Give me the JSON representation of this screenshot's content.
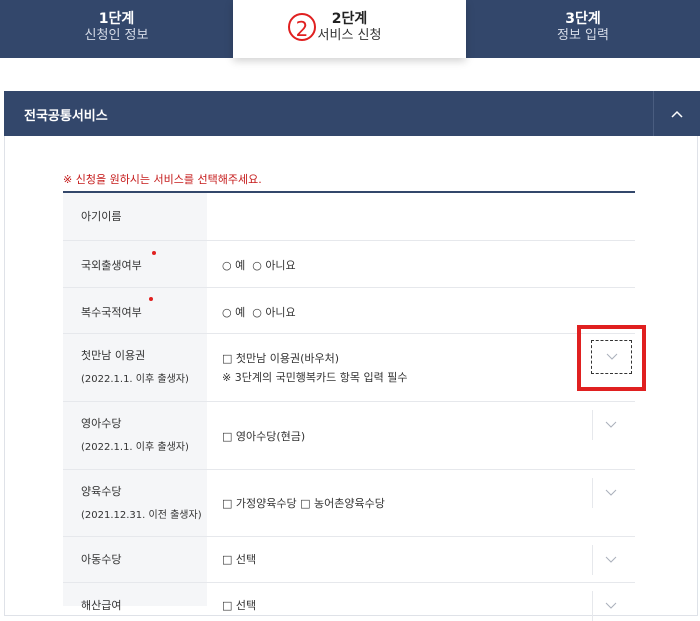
{
  "steps": [
    {
      "title": "1단계",
      "subtitle": "신청인 정보"
    },
    {
      "title": "2단계",
      "subtitle": "서비스 신청",
      "marker": "2"
    },
    {
      "title": "3단계",
      "subtitle": "정보 입력"
    }
  ],
  "section": {
    "title": "전국공통서비스"
  },
  "notice": "※ 신청을 원하시는 서비스를 선택해주세요.",
  "rows": [
    {
      "label": "아기이름"
    },
    {
      "label": "국외출생여부",
      "opt_yes": "○ 예",
      "opt_no": "○ 아니요"
    },
    {
      "label": "복수국적여부",
      "opt_yes": "○ 예",
      "opt_no": "○ 아니요"
    },
    {
      "label": "첫만남 이용권",
      "sublabel": "(2022.1.1. 이후 출생자)",
      "checkbox": "□ 첫만남 이용권(바우처)",
      "warning": "※ 3단계의 국민행복카드 항목 입력 필수"
    },
    {
      "label": "영아수당",
      "sublabel": "(2022.1.1. 이후 출생자)",
      "checkbox": "□ 영아수당(현금)"
    },
    {
      "label": "양육수당",
      "sublabel": "(2021.12.31. 이전 출생자)",
      "checkbox": "□ 가정양육수당 □ 농어촌양육수당"
    },
    {
      "label": "아동수당",
      "checkbox": "□ 선택"
    },
    {
      "label": "해산급여",
      "checkbox": "□ 선택"
    }
  ],
  "colors": {
    "primary": "#33476b",
    "accent_red": "#e02020",
    "notice_red": "#c51a1a"
  }
}
